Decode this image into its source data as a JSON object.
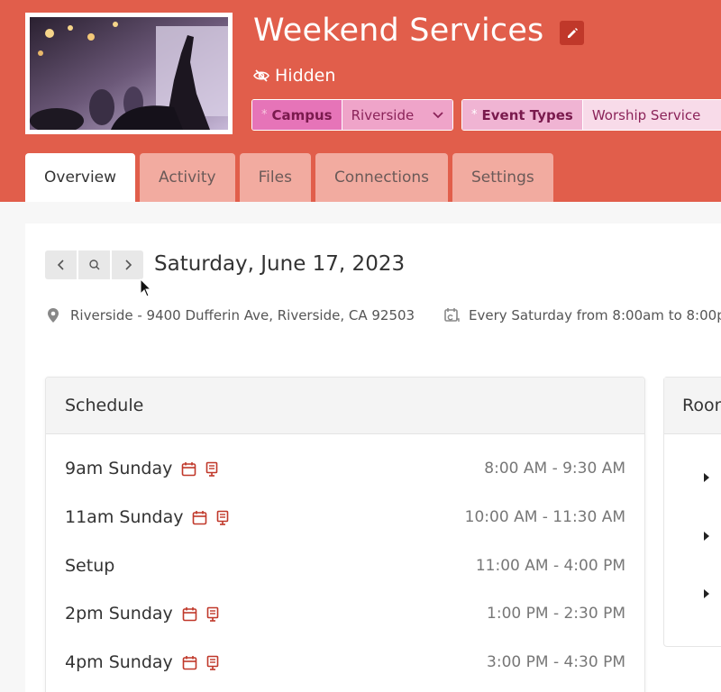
{
  "header": {
    "title": "Weekend Services",
    "visibility": "Hidden",
    "tags": [
      {
        "label": "Campus",
        "value": "Riverside"
      },
      {
        "label": "Event Types",
        "value": "Worship Service"
      }
    ],
    "required_marker": "*"
  },
  "tabs": [
    {
      "label": "Overview"
    },
    {
      "label": "Activity"
    },
    {
      "label": "Files"
    },
    {
      "label": "Connections"
    },
    {
      "label": "Settings"
    }
  ],
  "overview": {
    "date": "Saturday, June 17, 2023",
    "location": "Riverside - 9400 Dufferin Ave, Riverside, CA 92503",
    "recurrence": "Every Saturday from 8:00am to 8:00p"
  },
  "schedule": {
    "title": "Schedule",
    "items": [
      {
        "name": "9am Sunday",
        "time": "8:00 AM - 9:30 AM",
        "icons": true
      },
      {
        "name": "11am Sunday",
        "time": "10:00 AM - 11:30 AM",
        "icons": true
      },
      {
        "name": "Setup",
        "time": "11:00 AM - 4:00 PM",
        "icons": false
      },
      {
        "name": "2pm Sunday",
        "time": "1:00 PM - 2:30 PM",
        "icons": true
      },
      {
        "name": "4pm Sunday",
        "time": "3:00 PM - 4:30 PM",
        "icons": true
      }
    ]
  },
  "rooms": {
    "title": "Rooms"
  },
  "colors": {
    "header": "#e15e4b",
    "accent": "#c0382a",
    "tag": "#e674b8"
  }
}
